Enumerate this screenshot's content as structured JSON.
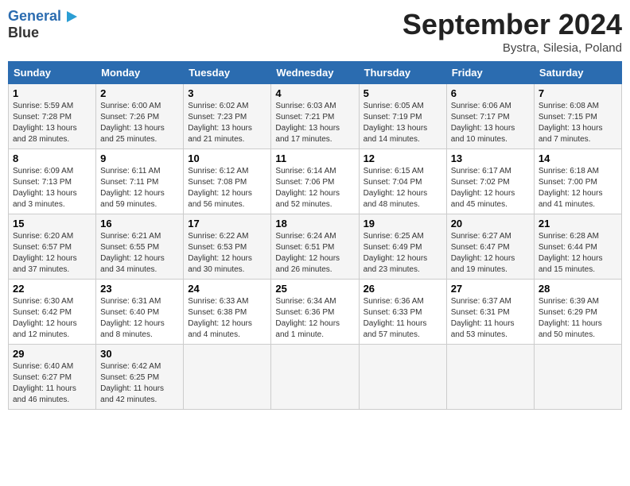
{
  "header": {
    "logo_line1": "General",
    "logo_line2": "Blue",
    "month": "September 2024",
    "location": "Bystra, Silesia, Poland"
  },
  "days_of_week": [
    "Sunday",
    "Monday",
    "Tuesday",
    "Wednesday",
    "Thursday",
    "Friday",
    "Saturday"
  ],
  "weeks": [
    [
      {
        "day": "1",
        "detail": "Sunrise: 5:59 AM\nSunset: 7:28 PM\nDaylight: 13 hours\nand 28 minutes."
      },
      {
        "day": "2",
        "detail": "Sunrise: 6:00 AM\nSunset: 7:26 PM\nDaylight: 13 hours\nand 25 minutes."
      },
      {
        "day": "3",
        "detail": "Sunrise: 6:02 AM\nSunset: 7:23 PM\nDaylight: 13 hours\nand 21 minutes."
      },
      {
        "day": "4",
        "detail": "Sunrise: 6:03 AM\nSunset: 7:21 PM\nDaylight: 13 hours\nand 17 minutes."
      },
      {
        "day": "5",
        "detail": "Sunrise: 6:05 AM\nSunset: 7:19 PM\nDaylight: 13 hours\nand 14 minutes."
      },
      {
        "day": "6",
        "detail": "Sunrise: 6:06 AM\nSunset: 7:17 PM\nDaylight: 13 hours\nand 10 minutes."
      },
      {
        "day": "7",
        "detail": "Sunrise: 6:08 AM\nSunset: 7:15 PM\nDaylight: 13 hours\nand 7 minutes."
      }
    ],
    [
      {
        "day": "8",
        "detail": "Sunrise: 6:09 AM\nSunset: 7:13 PM\nDaylight: 13 hours\nand 3 minutes."
      },
      {
        "day": "9",
        "detail": "Sunrise: 6:11 AM\nSunset: 7:11 PM\nDaylight: 12 hours\nand 59 minutes."
      },
      {
        "day": "10",
        "detail": "Sunrise: 6:12 AM\nSunset: 7:08 PM\nDaylight: 12 hours\nand 56 minutes."
      },
      {
        "day": "11",
        "detail": "Sunrise: 6:14 AM\nSunset: 7:06 PM\nDaylight: 12 hours\nand 52 minutes."
      },
      {
        "day": "12",
        "detail": "Sunrise: 6:15 AM\nSunset: 7:04 PM\nDaylight: 12 hours\nand 48 minutes."
      },
      {
        "day": "13",
        "detail": "Sunrise: 6:17 AM\nSunset: 7:02 PM\nDaylight: 12 hours\nand 45 minutes."
      },
      {
        "day": "14",
        "detail": "Sunrise: 6:18 AM\nSunset: 7:00 PM\nDaylight: 12 hours\nand 41 minutes."
      }
    ],
    [
      {
        "day": "15",
        "detail": "Sunrise: 6:20 AM\nSunset: 6:57 PM\nDaylight: 12 hours\nand 37 minutes."
      },
      {
        "day": "16",
        "detail": "Sunrise: 6:21 AM\nSunset: 6:55 PM\nDaylight: 12 hours\nand 34 minutes."
      },
      {
        "day": "17",
        "detail": "Sunrise: 6:22 AM\nSunset: 6:53 PM\nDaylight: 12 hours\nand 30 minutes."
      },
      {
        "day": "18",
        "detail": "Sunrise: 6:24 AM\nSunset: 6:51 PM\nDaylight: 12 hours\nand 26 minutes."
      },
      {
        "day": "19",
        "detail": "Sunrise: 6:25 AM\nSunset: 6:49 PM\nDaylight: 12 hours\nand 23 minutes."
      },
      {
        "day": "20",
        "detail": "Sunrise: 6:27 AM\nSunset: 6:47 PM\nDaylight: 12 hours\nand 19 minutes."
      },
      {
        "day": "21",
        "detail": "Sunrise: 6:28 AM\nSunset: 6:44 PM\nDaylight: 12 hours\nand 15 minutes."
      }
    ],
    [
      {
        "day": "22",
        "detail": "Sunrise: 6:30 AM\nSunset: 6:42 PM\nDaylight: 12 hours\nand 12 minutes."
      },
      {
        "day": "23",
        "detail": "Sunrise: 6:31 AM\nSunset: 6:40 PM\nDaylight: 12 hours\nand 8 minutes."
      },
      {
        "day": "24",
        "detail": "Sunrise: 6:33 AM\nSunset: 6:38 PM\nDaylight: 12 hours\nand 4 minutes."
      },
      {
        "day": "25",
        "detail": "Sunrise: 6:34 AM\nSunset: 6:36 PM\nDaylight: 12 hours\nand 1 minute."
      },
      {
        "day": "26",
        "detail": "Sunrise: 6:36 AM\nSunset: 6:33 PM\nDaylight: 11 hours\nand 57 minutes."
      },
      {
        "day": "27",
        "detail": "Sunrise: 6:37 AM\nSunset: 6:31 PM\nDaylight: 11 hours\nand 53 minutes."
      },
      {
        "day": "28",
        "detail": "Sunrise: 6:39 AM\nSunset: 6:29 PM\nDaylight: 11 hours\nand 50 minutes."
      }
    ],
    [
      {
        "day": "29",
        "detail": "Sunrise: 6:40 AM\nSunset: 6:27 PM\nDaylight: 11 hours\nand 46 minutes."
      },
      {
        "day": "30",
        "detail": "Sunrise: 6:42 AM\nSunset: 6:25 PM\nDaylight: 11 hours\nand 42 minutes."
      },
      {
        "day": "",
        "detail": ""
      },
      {
        "day": "",
        "detail": ""
      },
      {
        "day": "",
        "detail": ""
      },
      {
        "day": "",
        "detail": ""
      },
      {
        "day": "",
        "detail": ""
      }
    ]
  ]
}
